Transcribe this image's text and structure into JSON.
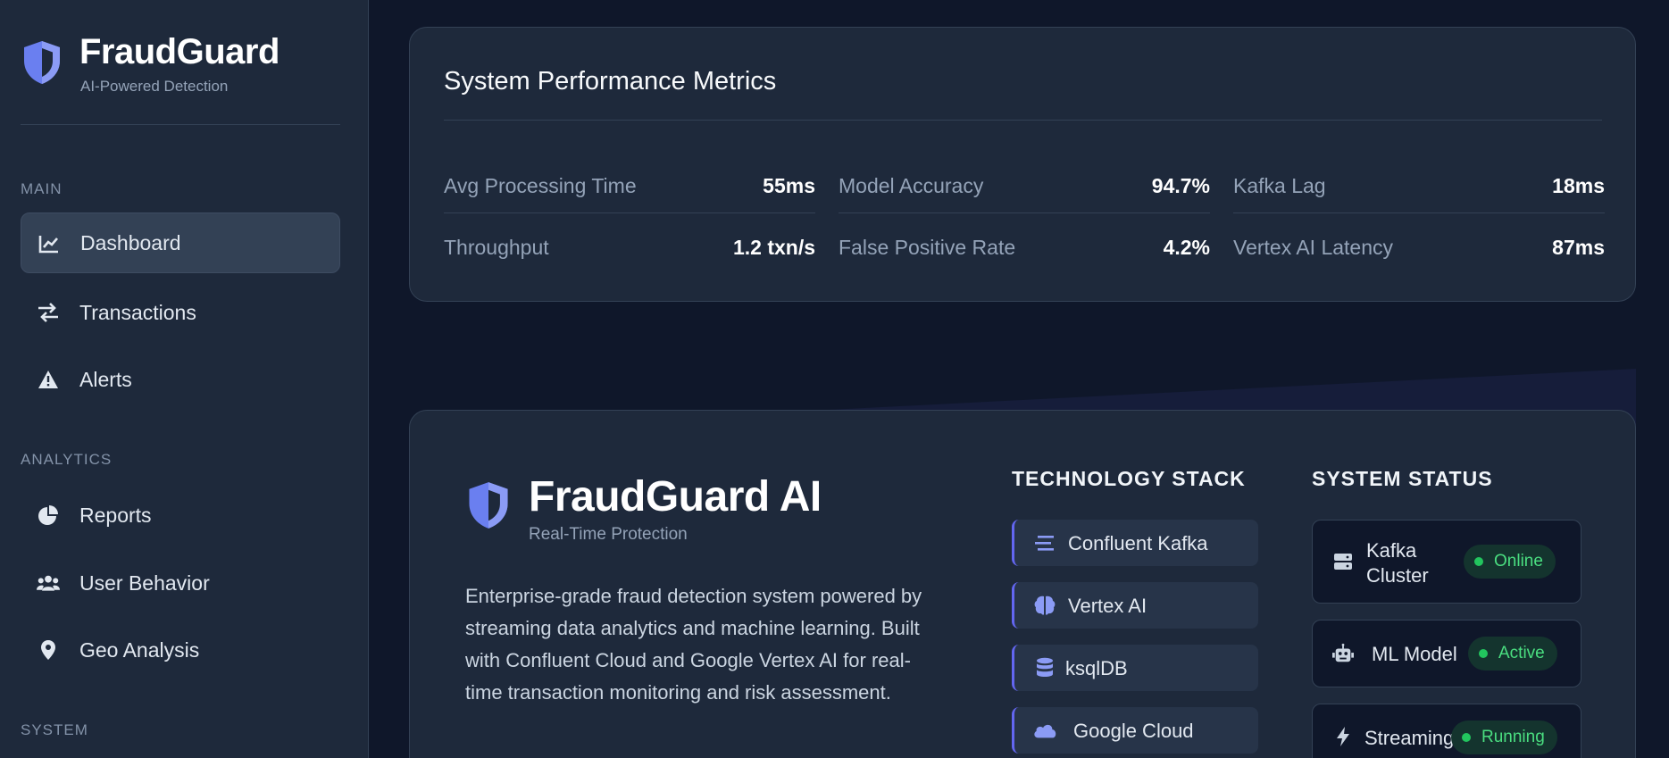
{
  "sidebar": {
    "brand": {
      "name": "FraudGuard",
      "subtitle": "AI-Powered Detection"
    },
    "sections": [
      {
        "label": "MAIN"
      },
      {
        "label": "ANALYTICS"
      },
      {
        "label": "SYSTEM"
      }
    ],
    "items": [
      {
        "label": "Dashboard",
        "icon": "chart-line-icon",
        "active": true
      },
      {
        "label": "Transactions",
        "icon": "exchange-arrows-icon"
      },
      {
        "label": "Alerts",
        "icon": "warning-triangle-icon"
      },
      {
        "label": "Reports",
        "icon": "pie-chart-icon"
      },
      {
        "label": "User Behavior",
        "icon": "users-icon"
      },
      {
        "label": "Geo Analysis",
        "icon": "map-pin-icon"
      }
    ]
  },
  "metrics": {
    "title": "System Performance Metrics",
    "items": [
      {
        "label": "Avg Processing Time",
        "value": "55ms"
      },
      {
        "label": "Model Accuracy",
        "value": "94.7%"
      },
      {
        "label": "Kafka Lag",
        "value": "18ms"
      },
      {
        "label": "Throughput",
        "value": "1.2 txn/s"
      },
      {
        "label": "False Positive Rate",
        "value": "4.2%"
      },
      {
        "label": "Vertex AI Latency",
        "value": "87ms"
      }
    ]
  },
  "about": {
    "name": "FraudGuard AI",
    "subtitle": "Real-Time Protection",
    "description": "Enterprise-grade fraud detection system powered by streaming data analytics and machine learning. Built with Confluent Cloud and Google Vertex AI for real-time transaction monitoring and risk assessment.",
    "tech_heading": "TECHNOLOGY STACK",
    "tech": [
      {
        "label": "Confluent Kafka",
        "icon": "stream-lines-icon"
      },
      {
        "label": "Vertex AI",
        "icon": "brain-icon"
      },
      {
        "label": "ksqlDB",
        "icon": "database-icon"
      },
      {
        "label": "Google Cloud",
        "icon": "cloud-icon"
      }
    ],
    "status_heading": "SYSTEM STATUS",
    "status": [
      {
        "label": "Kafka Cluster",
        "state": "Online",
        "icon": "server-icon"
      },
      {
        "label": "ML Model",
        "state": "Active",
        "icon": "robot-icon"
      },
      {
        "label": "Streaming",
        "state": "Running",
        "icon": "bolt-icon"
      }
    ]
  },
  "colors": {
    "accent": "#6366f1",
    "sidebar_bg": "#1e293b",
    "page_bg": "#0f172a",
    "status_green": "#4ade80"
  }
}
